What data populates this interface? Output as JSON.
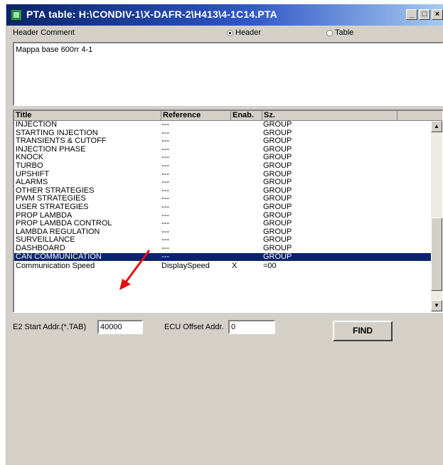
{
  "window": {
    "title": "PTA table: H:\\CONDIV-1\\X-DAFR-2\\H413\\4-1C14.PTA",
    "minimize_label": "_",
    "maximize_label": "□",
    "close_label": "×"
  },
  "header": {
    "comment_label": "Header Comment",
    "radio_header_label": "Header",
    "radio_table_label": "Table",
    "selected_radio": "Header",
    "comment_text": "Mappa base 600rr 4-1"
  },
  "table": {
    "columns": [
      "Title",
      "Reference",
      "Enab.",
      "Sz."
    ],
    "rows": [
      {
        "title": "INJECTION",
        "reference": "---",
        "enab": "",
        "sz": "GROUP"
      },
      {
        "title": "STARTING INJECTION",
        "reference": "---",
        "enab": "",
        "sz": "GROUP"
      },
      {
        "title": "TRANSIENTS & CUTOFF",
        "reference": "---",
        "enab": "",
        "sz": "GROUP"
      },
      {
        "title": "INJECTION PHASE",
        "reference": "---",
        "enab": "",
        "sz": "GROUP"
      },
      {
        "title": "KNOCK",
        "reference": "---",
        "enab": "",
        "sz": "GROUP"
      },
      {
        "title": "TURBO",
        "reference": "---",
        "enab": "",
        "sz": "GROUP"
      },
      {
        "title": "UPSHIFT",
        "reference": "---",
        "enab": "",
        "sz": "GROUP"
      },
      {
        "title": "ALARMS",
        "reference": "---",
        "enab": "",
        "sz": "GROUP"
      },
      {
        "title": "OTHER STRATEGIES",
        "reference": "---",
        "enab": "",
        "sz": "GROUP"
      },
      {
        "title": "PWM STRATEGIES",
        "reference": "---",
        "enab": "",
        "sz": "GROUP"
      },
      {
        "title": "USER STRATEGIES",
        "reference": "---",
        "enab": "",
        "sz": "GROUP"
      },
      {
        "title": "PROP LAMBDA",
        "reference": "---",
        "enab": "",
        "sz": "GROUP"
      },
      {
        "title": "PROP LAMBDA CONTROL",
        "reference": "---",
        "enab": "",
        "sz": "GROUP"
      },
      {
        "title": "LAMBDA REGULATION",
        "reference": "---",
        "enab": "",
        "sz": "GROUP"
      },
      {
        "title": "SURVEILLANCE",
        "reference": "---",
        "enab": "",
        "sz": "GROUP"
      },
      {
        "title": "DASHBOARD",
        "reference": "---",
        "enab": "",
        "sz": "GROUP"
      },
      {
        "title": "CAN COMMUNICATION",
        "reference": "---",
        "enab": "",
        "sz": "GROUP"
      },
      {
        "title": "Communication Speed",
        "reference": "DisplaySpeed",
        "enab": "X",
        "sz": "=00"
      }
    ],
    "selected_row": "CAN COMMUNICATION",
    "scroll_up_icon": "▲",
    "scroll_down_icon": "▼"
  },
  "footer": {
    "e2_label": "E2 Start Addr.(*.TAB)",
    "e2_value": "40000",
    "ecu_label": "ECU Offset Addr.",
    "ecu_value": "0",
    "find_label": "FIND"
  },
  "colors": {
    "selection": "#0a246a",
    "annotation_arrow": "#e01010"
  }
}
